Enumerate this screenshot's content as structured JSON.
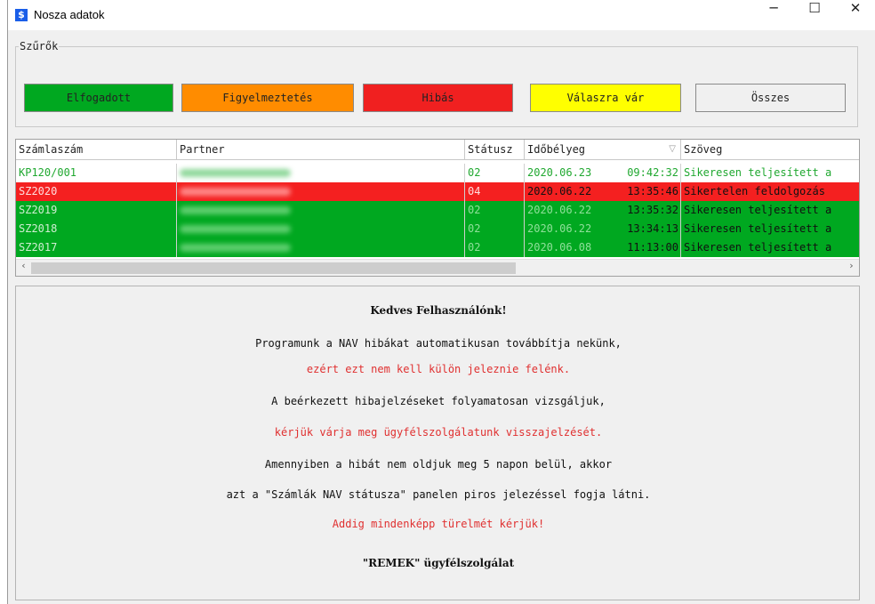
{
  "window": {
    "title": "Nosza adatok",
    "icon_letter": "$",
    "controls": {
      "minimize": "─",
      "maximize": "☐",
      "close": "✕"
    }
  },
  "filters": {
    "group_label": "Szűrők",
    "buttons": [
      {
        "label": "Elfogadott",
        "color": "#00a820"
      },
      {
        "label": "Figyelmeztetés",
        "color": "#ff8c00"
      },
      {
        "label": "Hibás",
        "color": "#f02020"
      },
      {
        "label": "Válaszra vár",
        "color": "#ffff00"
      },
      {
        "label": "Összes",
        "color": "#f0f0f0"
      }
    ]
  },
  "grid": {
    "columns": [
      "Számlaszám",
      "Partner",
      "Státusz",
      "Időbélyeg",
      "Szöveg"
    ],
    "sort_icon": "▽",
    "rows": [
      {
        "invoice": "KP120/001",
        "status": "02",
        "date": "2020.06.23",
        "time": "09:42:32",
        "text": "Sikeresen teljesített a",
        "style": "plain"
      },
      {
        "invoice": "SZ2020",
        "status": "04",
        "date": "2020.06.22",
        "time": "13:35:46",
        "text": "Sikertelen feldolgozás",
        "style": "error"
      },
      {
        "invoice": "SZ2019",
        "status": "02",
        "date": "2020.06.22",
        "time": "13:35:32",
        "text": "Sikeresen teljesített a",
        "style": "ok"
      },
      {
        "invoice": "SZ2018",
        "status": "02",
        "date": "2020.06.22",
        "time": "13:34:13",
        "text": "Sikeresen teljesített a",
        "style": "ok"
      },
      {
        "invoice": "SZ2017",
        "status": "02",
        "date": "2020.06.08",
        "time": "11:13:00",
        "text": "Sikeresen teljesített a",
        "style": "ok"
      }
    ],
    "scroll_left": "‹",
    "scroll_right": "›"
  },
  "message": {
    "lines": [
      "Kedves Felhasználónk!",
      "Programunk a NAV hibákat automatikusan továbbítja nekünk,",
      "ezért ezt nem kell külön jeleznie felénk.",
      "A beérkezett hibajelzéseket folyamatosan vizsgáljuk,",
      "kérjük várja meg ügyfélszolgálatunk visszajelzését.",
      "Amennyiben a hibát nem oldjuk meg 5 napon belül, akkor",
      "azt a \"Számlák NAV státusza\" panelen piros jelezéssel fogja látni.",
      "Addig mindenképp türelmét kérjük!",
      "\"REMEK\" ügyfélszolgálat"
    ]
  }
}
